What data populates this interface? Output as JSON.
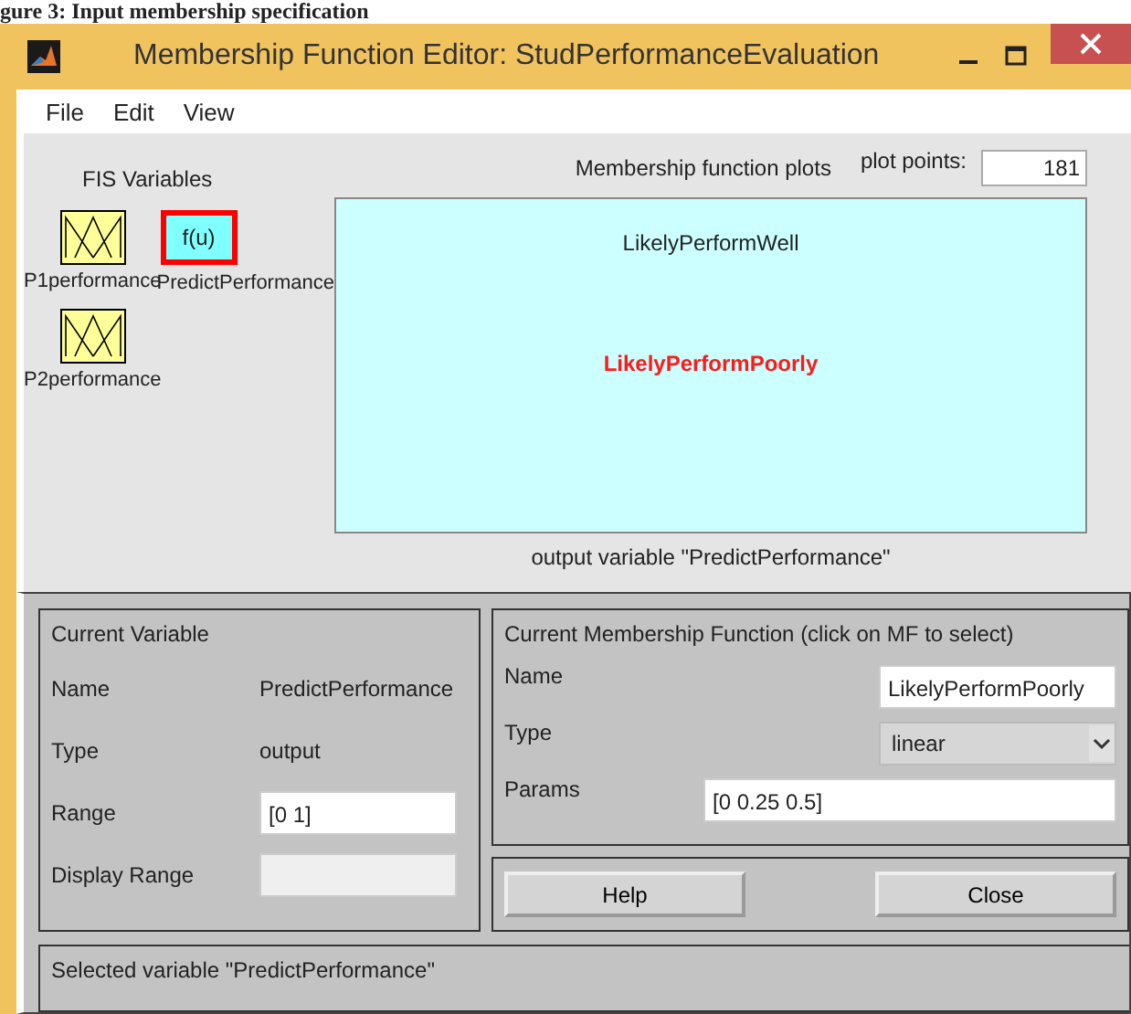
{
  "caption": "gure 3: Input membership specification",
  "window": {
    "title": "Membership Function Editor: StudPerformanceEvaluation"
  },
  "menu": [
    "File",
    "Edit",
    "View"
  ],
  "fis_variables": {
    "title": "FIS Variables",
    "variables": [
      {
        "kind": "input",
        "label": "P1performance",
        "selected": false
      },
      {
        "kind": "output",
        "label": "PredictPerformance",
        "icon_text": "f(u)",
        "selected": true
      },
      {
        "kind": "input",
        "label": "P2performance",
        "selected": false
      }
    ]
  },
  "plot": {
    "title": "Membership function plots",
    "plot_points_label": "plot points:",
    "plot_points": "181",
    "mfs": [
      {
        "label": "LikelyPerformWell",
        "selected": false
      },
      {
        "label": "LikelyPerformPoorly",
        "selected": true
      }
    ],
    "caption": "output variable \"PredictPerformance\""
  },
  "current_variable": {
    "title": "Current Variable",
    "name_label": "Name",
    "name": "PredictPerformance",
    "type_label": "Type",
    "type": "output",
    "range_label": "Range",
    "range": "[0 1]",
    "display_range_label": "Display Range"
  },
  "current_mf": {
    "title": "Current Membership Function (click on MF to select)",
    "name_label": "Name",
    "name": "LikelyPerformPoorly",
    "type_label": "Type",
    "type": "linear",
    "params_label": "Params",
    "params": "[0 0.25 0.5]"
  },
  "buttons": [
    "Help",
    "Close"
  ],
  "status": "Selected variable \"PredictPerformance\""
}
